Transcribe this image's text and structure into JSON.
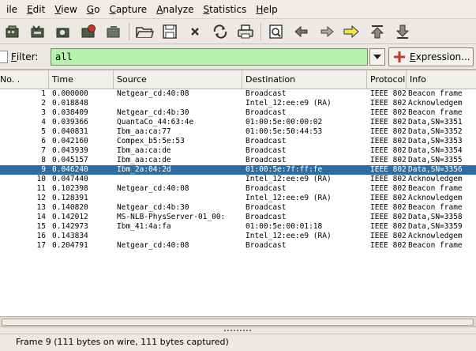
{
  "menu": {
    "items": [
      {
        "label": "File",
        "visible": "ile",
        "ul": ""
      },
      {
        "label": "Edit",
        "visible": "dit",
        "ul": "E"
      },
      {
        "label": "View",
        "visible": "iew",
        "ul": "V"
      },
      {
        "label": "Go",
        "visible": "o",
        "ul": "G"
      },
      {
        "label": "Capture",
        "visible": "apture",
        "ul": "C"
      },
      {
        "label": "Analyze",
        "visible": "nalyze",
        "ul": "A"
      },
      {
        "label": "Statistics",
        "visible": "tatistics",
        "ul": "S"
      },
      {
        "label": "Help",
        "visible": "elp",
        "ul": "H"
      }
    ]
  },
  "toolbar": {
    "icons": [
      "interface-list-icon",
      "capture-options-icon",
      "start-capture-icon",
      "stop-capture-icon",
      "restart-capture-icon",
      "open-file-icon",
      "save-file-icon",
      "close-file-icon",
      "reload-icon",
      "print-icon",
      "find-packet-icon",
      "go-back-icon",
      "go-forward-icon",
      "go-to-packet-icon",
      "go-first-icon",
      "go-last-icon"
    ]
  },
  "filter": {
    "label_ul": "F",
    "label_rest": "ilter:",
    "value": "all",
    "expression_ul": "E",
    "expression_rest": "xpression..."
  },
  "packet_list": {
    "columns": [
      "No. .",
      "Time",
      "Source",
      "Destination",
      "Protocol",
      "Info"
    ],
    "selected_index": 8,
    "rows": [
      {
        "no": "1",
        "time": "0.000000",
        "source": "Netgear_cd:40:08",
        "destination": "Broadcast",
        "protocol": "IEEE 802",
        "info": "Beacon frame"
      },
      {
        "no": "2",
        "time": "0.018848",
        "source": "",
        "destination": "Intel_12:ee:e9 (RA)",
        "protocol": "IEEE 802",
        "info": "Acknowledgem"
      },
      {
        "no": "3",
        "time": "0.038409",
        "source": "Netgear_cd:4b:30",
        "destination": "Broadcast",
        "protocol": "IEEE 802",
        "info": "Beacon frame"
      },
      {
        "no": "4",
        "time": "0.039366",
        "source": "QuantaCo_44:63:4e",
        "destination": "01:00:5e:00:00:02",
        "protocol": "IEEE 802",
        "info": "Data,SN=3351"
      },
      {
        "no": "5",
        "time": "0.040831",
        "source": "Ibm_aa:ca:77",
        "destination": "01:00:5e:50:44:53",
        "protocol": "IEEE 802",
        "info": "Data,SN=3352"
      },
      {
        "no": "6",
        "time": "0.042160",
        "source": "Compex_b5:5e:53",
        "destination": "Broadcast",
        "protocol": "IEEE 802",
        "info": "Data,SN=3353"
      },
      {
        "no": "7",
        "time": "0.043939",
        "source": "Ibm_aa:ca:de",
        "destination": "Broadcast",
        "protocol": "IEEE 802",
        "info": "Data,SN=3354"
      },
      {
        "no": "8",
        "time": "0.045157",
        "source": "Ibm_aa:ca:de",
        "destination": "Broadcast",
        "protocol": "IEEE 802",
        "info": "Data,SN=3355"
      },
      {
        "no": "9",
        "time": "0.046240",
        "source": "Ibm_2a:04:2d",
        "destination": "01:00:5e:7f:ff:fe",
        "protocol": "IEEE 802",
        "info": "Data,SN=3356"
      },
      {
        "no": "10",
        "time": "0.047440",
        "source": "",
        "destination": "Intel_12:ee:e9 (RA)",
        "protocol": "IEEE 802",
        "info": "Acknowledgem"
      },
      {
        "no": "11",
        "time": "0.102398",
        "source": "Netgear_cd:40:08",
        "destination": "Broadcast",
        "protocol": "IEEE 802",
        "info": "Beacon frame"
      },
      {
        "no": "12",
        "time": "0.128391",
        "source": "",
        "destination": "Intel_12:ee:e9 (RA)",
        "protocol": "IEEE 802",
        "info": "Acknowledgem"
      },
      {
        "no": "13",
        "time": "0.140820",
        "source": "Netgear_cd:4b:30",
        "destination": "Broadcast",
        "protocol": "IEEE 802",
        "info": "Beacon frame"
      },
      {
        "no": "14",
        "time": "0.142012",
        "source": "MS-NLB-PhysServer-01_00:",
        "destination": "Broadcast",
        "protocol": "IEEE 802",
        "info": "Data,SN=3358"
      },
      {
        "no": "15",
        "time": "0.142973",
        "source": "Ibm_41:4a:fa",
        "destination": "01:00:5e:00:01:18",
        "protocol": "IEEE 802",
        "info": "Data,SN=3359"
      },
      {
        "no": "16",
        "time": "0.143834",
        "source": "",
        "destination": "Intel_12:ee:e9 (RA)",
        "protocol": "IEEE 802",
        "info": "Acknowledgem"
      },
      {
        "no": "17",
        "time": "0.204791",
        "source": "Netgear_cd:40:08",
        "destination": "Broadcast",
        "protocol": "IEEE 802",
        "info": "Beacon frame"
      }
    ]
  },
  "status": {
    "text": "Frame 9 (111 bytes on wire, 111 bytes captured)"
  }
}
